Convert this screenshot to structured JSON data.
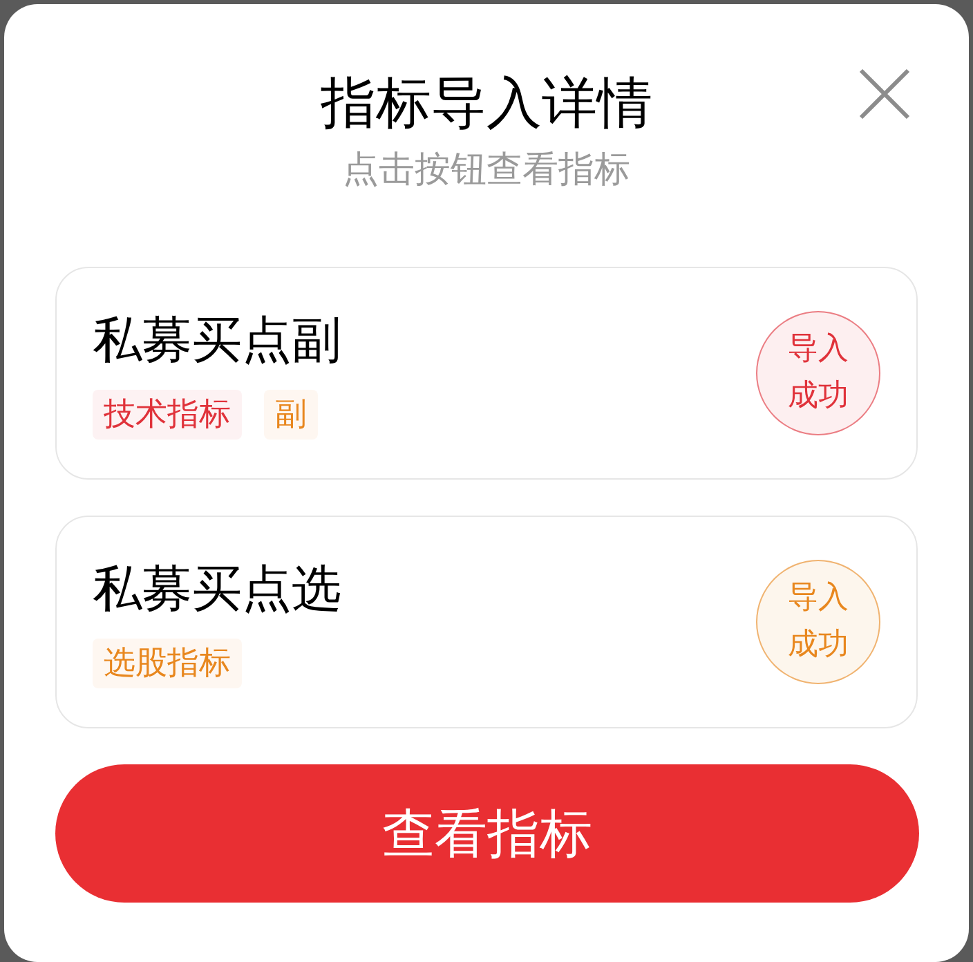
{
  "dialog": {
    "title": "指标导入详情",
    "subtitle": "点击按钮查看指标"
  },
  "items": [
    {
      "name": "私募买点副",
      "tags": [
        {
          "label": "技术指标",
          "color": "#e0323a"
        },
        {
          "label": "副",
          "color": "#e8871e"
        }
      ],
      "status": "导入成功",
      "color": "#e0323a"
    },
    {
      "name": "私募买点选",
      "tags": [
        {
          "label": "选股指标",
          "color": "#e8871e"
        }
      ],
      "status": "导入成功",
      "color": "#e8871e"
    }
  ],
  "button": "查看指标"
}
